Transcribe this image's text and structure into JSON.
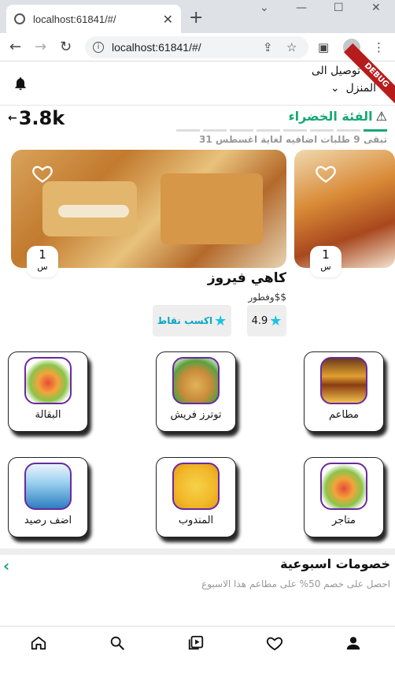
{
  "browser": {
    "tab_title": "localhost:61841/#/",
    "url": "localhost:61841/#/"
  },
  "header": {
    "deliver_to": "توصيل الى",
    "destination": "المنزل",
    "debug_banner": "DEBUG"
  },
  "category": {
    "points": "3.8k",
    "title": "الفئة الخضراء",
    "subtitle": "تبقى 9 طلبات اضافيه لغاية اغسطس 31",
    "progress_segments": 8,
    "progress_filled": 1
  },
  "restaurants": [
    {
      "time_value": "1",
      "time_unit": "س"
    },
    {
      "time_value": "1",
      "time_unit": "س"
    }
  ],
  "featured": {
    "name": "كاهي فيروز",
    "description": "وفطور$$",
    "rating": "4.9",
    "earn_points": "اكسب نقاط"
  },
  "services": [
    {
      "label": "مطاعم",
      "icon": "burger-icon"
    },
    {
      "label": "توترز فريش",
      "icon": "vegetables-bag-icon"
    },
    {
      "label": "البقالة",
      "icon": "grocery-cart-icon"
    },
    {
      "label": "متاجر",
      "icon": "shopping-cart-icon"
    },
    {
      "label": "المندوب",
      "icon": "courier-icon"
    },
    {
      "label": "اضف رصيد",
      "icon": "bank-transfer-icon"
    }
  ],
  "discounts": {
    "title": "خصومات اسبوعية",
    "subtitle": "احصل على خصم 50% على مطاعم هذا الاسبوع"
  },
  "colors": {
    "accent": "#18a874",
    "star": "#18c4e6",
    "icon_border": "#6a2a9c"
  }
}
